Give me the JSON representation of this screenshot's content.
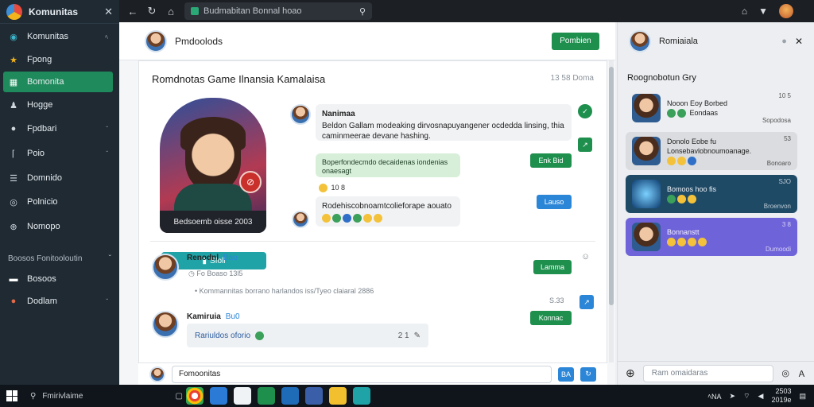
{
  "sidebar": {
    "title": "Komunitas",
    "items": [
      {
        "label": "Komunitas",
        "icon": "compass-icon",
        "suffix": "ﾍ"
      },
      {
        "label": "Fpong",
        "icon": "star-icon",
        "suffix": ""
      },
      {
        "label": "Bomonita",
        "icon": "grid-icon",
        "suffix": ""
      },
      {
        "label": "Hogge",
        "icon": "user-icon",
        "suffix": ""
      },
      {
        "label": "Fpdbari",
        "icon": "chat-icon",
        "suffix": "ˇ"
      },
      {
        "label": "Poio",
        "icon": "bracket-icon",
        "suffix": "ˇ"
      },
      {
        "label": "Domnido",
        "icon": "list-icon",
        "suffix": ""
      },
      {
        "label": "Polnicio",
        "icon": "circle-icon",
        "suffix": ""
      },
      {
        "label": "Nomopo",
        "icon": "globe-icon",
        "suffix": ""
      }
    ],
    "section_label": "Boosos Fonitooloutin",
    "sub_items": [
      {
        "label": "Bosoos",
        "icon": "card-icon"
      },
      {
        "label": "Dodlam",
        "icon": "avatar-icon",
        "suffix": "ˇ"
      }
    ]
  },
  "topbar": {
    "url": "Budmabitan Bonnal hoao"
  },
  "main": {
    "header_name": "Pmdoolods",
    "header_button": "Pombien",
    "card_title": "Romdnotas Game Ilnansia Kamalaisa",
    "card_time": "13 58 Doma",
    "hero_caption": "Bedsoemb oisse 2003",
    "hero_button": "Sfoll",
    "messages": {
      "m1_name": "Nanimaa",
      "m1_text": "Beldon Gallam modeaking dirvosnapuyangener ocdedda linsing, thia caminmeerae devane hashing.",
      "m2_text": "Boperfondecmdo decaidenas iondenias onaesagt",
      "m2_react": "10 8",
      "m3_text": "Rodehiscobnoamtcolieforape aouato",
      "pill_1": "Enk Bid",
      "pill_2": "Lauso"
    },
    "posts": [
      {
        "name": "Renodnl",
        "tag": "Bao",
        "line1": "Fo Boaso 13l5",
        "line2": "Kommannitas borrano harlandos iss/Tyeo claiaral 2886",
        "button": "Lamma",
        "time": "S.33"
      },
      {
        "name": "Kamiruia",
        "tag": "Bu0",
        "reply": "Rariuldos oforio",
        "reply_count": "2 1",
        "button": "Konnac"
      }
    ],
    "composer_placeholder": "Fomoonitas",
    "composer_btn": "BA"
  },
  "right_panel": {
    "title": "Romiaiala",
    "section": "Roognobotun Gry",
    "cards": [
      {
        "line1": "Nooon Eoy Borbed",
        "line2": "Eondaas",
        "meta1": "10 5",
        "meta2": "Sopodosa",
        "bg": "#eceef1",
        "fg": "#222"
      },
      {
        "line1": "Donolo Eobe fu",
        "line2": "Lonsebavlobnoumoanage.",
        "meta1": "53",
        "meta2": "Bonoaro",
        "bg": "#dfe1e4",
        "fg": "#222"
      },
      {
        "line1": "Bomoos hoo fis",
        "line2": "",
        "meta1": "SJO",
        "meta2": "Broenvon",
        "bg": "#1f4a66",
        "fg": "#eef3f7"
      },
      {
        "line1": "Bonnanstt",
        "line2": "",
        "meta1": "3 8",
        "meta2": "Dumoodi",
        "bg": "#6f63d9",
        "fg": "#f4f3ff"
      }
    ],
    "search_placeholder": "Ram omaidaras"
  },
  "taskbar": {
    "search": "Fmirivlaime",
    "tray": "ﾍNA",
    "clock_time": "2503",
    "clock_date": "2019e"
  },
  "colors": {
    "accent": "#1f8f4e",
    "sidebar_bg": "#1f2a33",
    "link_blue": "#2c86d8"
  }
}
